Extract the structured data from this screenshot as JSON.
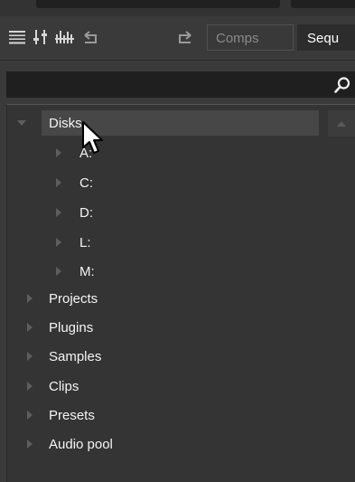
{
  "toolbar": {
    "icons": [
      "menu-icon",
      "mixer-icon",
      "waveform-icon",
      "undo-icon",
      "redo-icon"
    ],
    "buttons": [
      {
        "label": "Comps",
        "active": false
      },
      {
        "label": "Sequ",
        "active": true
      }
    ]
  },
  "search": {
    "value": "",
    "placeholder": "",
    "icon": "search-icon"
  },
  "tree": {
    "items": [
      {
        "label": "Disks",
        "expanded": true,
        "selected": true,
        "children": [
          {
            "label": "A:"
          },
          {
            "label": "C:"
          },
          {
            "label": "D:"
          },
          {
            "label": "L:"
          },
          {
            "label": "M:"
          }
        ]
      },
      {
        "label": "Projects",
        "expanded": false
      },
      {
        "label": "Plugins",
        "expanded": false
      },
      {
        "label": "Samples",
        "expanded": false
      },
      {
        "label": "Clips",
        "expanded": false
      },
      {
        "label": "Presets",
        "expanded": false
      },
      {
        "label": "Audio pool",
        "expanded": false
      }
    ]
  },
  "colors": {
    "background": "#3a3a3a",
    "panel": "#343434",
    "selected_row": "#474747",
    "search_bg": "#1f1f1f",
    "text": "#f4f4f4",
    "active_button": "#2c2c2c"
  }
}
